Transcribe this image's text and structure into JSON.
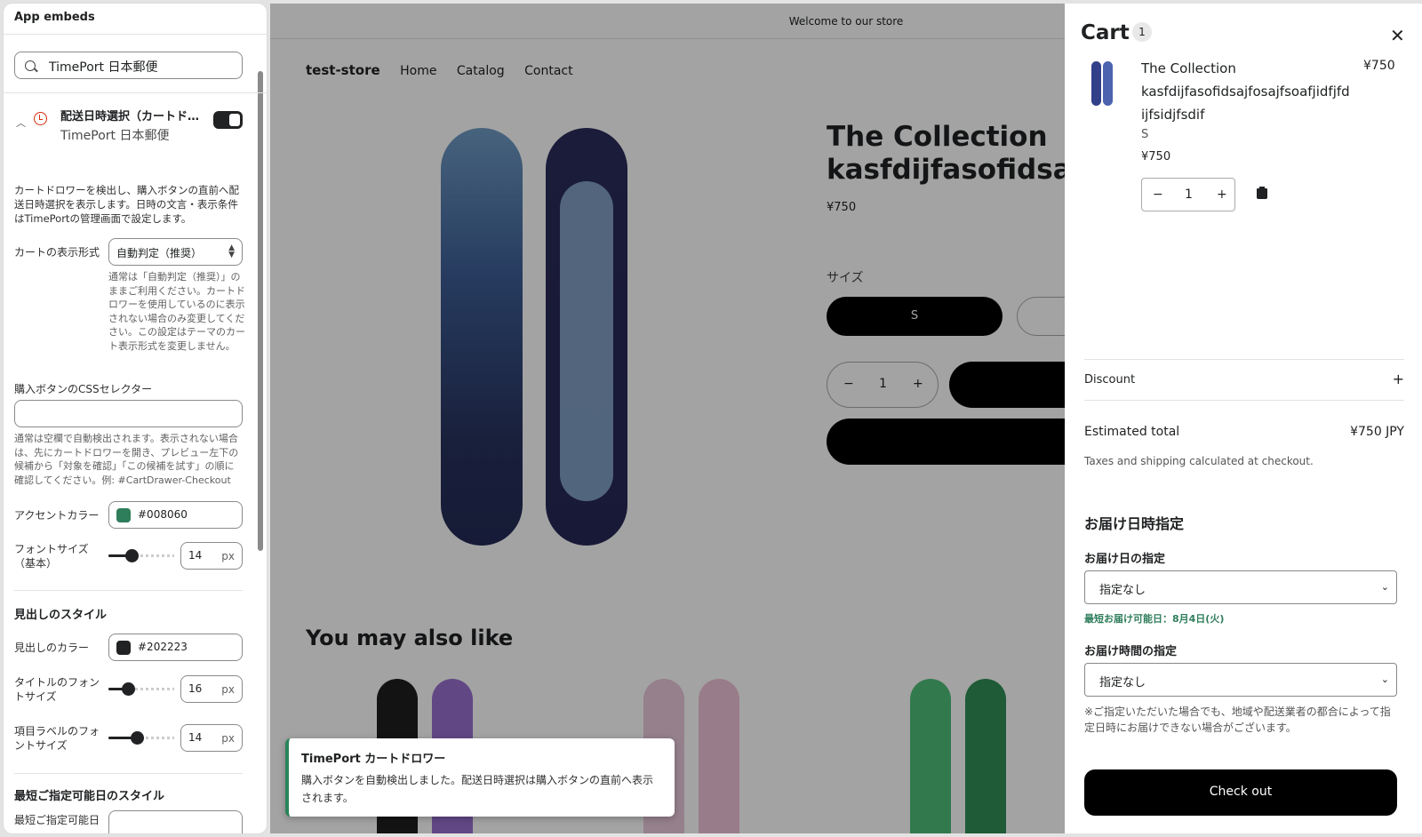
{
  "left_panel": {
    "title": "App embeds",
    "search_value": "TimePort 日本郵便",
    "embed": {
      "title": "配送日時選択（カートド…",
      "subtitle": "TimePort 日本郵便",
      "enabled": true
    },
    "description": "カートドロワーを検出し、購入ボタンの直前へ配送日時選択を表示します。日時の文言・表示条件はTimePortの管理画面で設定します。",
    "cart_format": {
      "label": "カートの表示形式",
      "value": "自動判定（推奨）",
      "help": "通常は「自動判定（推奨）」のままご利用ください。カートドロワーを使用しているのに表示されない場合のみ変更してください。この設定はテーマのカート表示形式を変更しません。"
    },
    "css_selector": {
      "label": "購入ボタンのCSSセレクター",
      "value": "",
      "help": "通常は空欄で自動検出されます。表示されない場合は、先にカートドロワーを開き、プレビュー左下の候補から「対象を確認」「この候補を試す」の順に確認してください。例: #CartDrawer-Checkout"
    },
    "accent_color": {
      "label": "アクセントカラー",
      "value": "#008060"
    },
    "font_size_base": {
      "label": "フォントサイズ（基本）",
      "value": "14",
      "unit": "px",
      "fraction": 0.35
    },
    "heading_style": {
      "title": "見出しのスタイル",
      "color": {
        "label": "見出しのカラー",
        "value": "#202223"
      },
      "title_font": {
        "label": "タイトルのフォントサイズ",
        "value": "16",
        "unit": "px",
        "fraction": 0.3
      },
      "label_font": {
        "label": "項目ラベルのフォントサイズ",
        "value": "14",
        "unit": "px",
        "fraction": 0.43
      }
    },
    "earliest_style_title": "最短ご指定可能日のスタイル",
    "cut_label": "最短ご指定可能日"
  },
  "store": {
    "announcement": "Welcome to our store",
    "nav": {
      "logo": "test-store",
      "links": [
        "Home",
        "Catalog",
        "Contact"
      ]
    },
    "product": {
      "title": "The Collection kasfdijfasofidsajfo",
      "price": "¥750",
      "size_label": "サイズ",
      "size_selected": "S",
      "quantity": "1"
    },
    "also_like": "You may also like"
  },
  "toast": {
    "title": "TimePort カートドロワー",
    "body": "購入ボタンを自動検出しました。配送日時選択は購入ボタンの直前へ表示されます。"
  },
  "cart": {
    "title": "Cart",
    "count": "1",
    "item": {
      "name": "The Collection kasfdijfasofidsajfosajfsoafjidfjfd ijfsidjfsdif",
      "price": "¥750",
      "variant": "S",
      "unit_price": "¥750",
      "quantity": "1"
    },
    "discount_label": "Discount",
    "estimated_total_label": "Estimated total",
    "estimated_total_value": "¥750 JPY",
    "tax_note": "Taxes and shipping calculated at checkout.",
    "delivery": {
      "heading": "お届け日時指定",
      "date_label": "お届け日の指定",
      "date_value": "指定なし",
      "earliest": "最短お届け可能日：8月4日(火)",
      "time_label": "お届け時間の指定",
      "time_value": "指定なし",
      "note": "※ご指定いただいた場合でも、地域や配送業者の都合によって指定日時にお届けできない場合がございます。"
    },
    "checkout_label": "Check out"
  },
  "colors": {
    "accent": "#008060",
    "heading": "#202223",
    "earliest_text": "#2e7d5b"
  }
}
